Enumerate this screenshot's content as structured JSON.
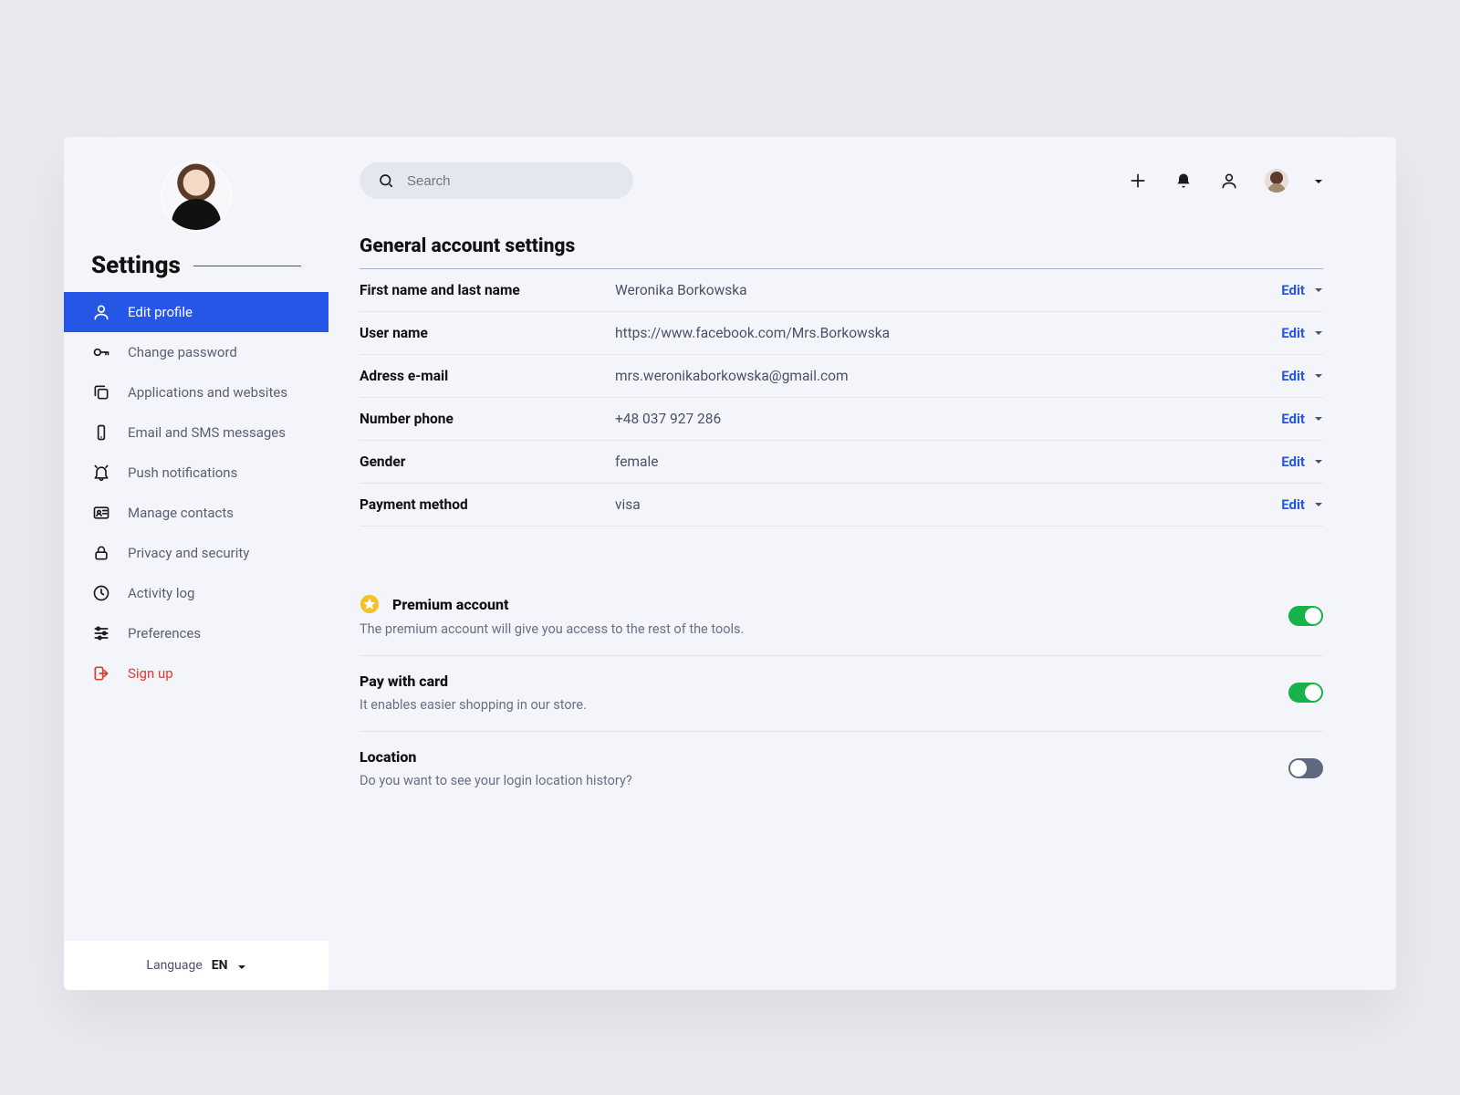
{
  "sidebar": {
    "title": "Settings",
    "items": [
      {
        "label": "Edit profile"
      },
      {
        "label": "Change password"
      },
      {
        "label": "Applications and websites"
      },
      {
        "label": "Email and SMS messages"
      },
      {
        "label": "Push notifications"
      },
      {
        "label": "Manage contacts"
      },
      {
        "label": "Privacy and security"
      },
      {
        "label": "Activity log"
      },
      {
        "label": "Preferences"
      },
      {
        "label": "Sign up"
      }
    ],
    "language_label": "Language",
    "language_code": "EN"
  },
  "header": {
    "search_placeholder": "Search"
  },
  "page": {
    "title": "General account settings",
    "edit_label": "Edit",
    "rows": [
      {
        "label": "First name and last name",
        "value": "Weronika Borkowska"
      },
      {
        "label": "User name",
        "value": "https://www.facebook.com/Mrs.Borkowska"
      },
      {
        "label": "Adress e-mail",
        "value": "mrs.weronikaborkowska@gmail.com"
      },
      {
        "label": "Number phone",
        "value": "+48 037 927 286"
      },
      {
        "label": "Gender",
        "value": "female"
      },
      {
        "label": "Payment method",
        "value": "visa"
      }
    ],
    "options": [
      {
        "title": "Premium account",
        "desc": "The premium account will give you access to the rest of the tools.",
        "on": true,
        "star": true
      },
      {
        "title": "Pay with card",
        "desc": "It enables easier shopping in our store.",
        "on": true,
        "star": false
      },
      {
        "title": "Location",
        "desc": "Do you want to see your login location history?",
        "on": false,
        "star": false
      }
    ]
  }
}
